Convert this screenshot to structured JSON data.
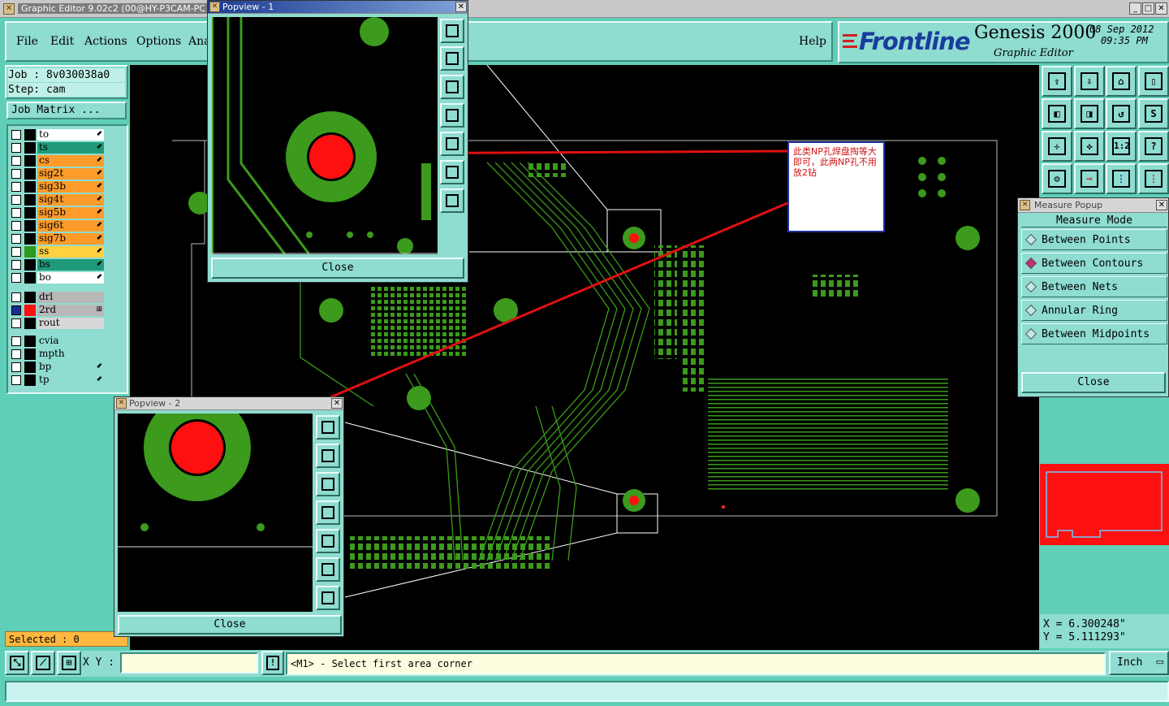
{
  "window": {
    "title": "Graphic Editor 9.02c2 (00@HY-P3CAM-PC"
  },
  "menu": {
    "file": "File",
    "edit": "Edit",
    "actions": "Actions",
    "options": "Options",
    "analysis": "Ana",
    "help": "Help"
  },
  "logo": {
    "brand": "Frontline",
    "product": "Genesis 2000",
    "subtitle": "Graphic Editor",
    "date": "08 Sep 2012",
    "time": "09:35 PM"
  },
  "job": {
    "job_label": "Job : 8v030038a0",
    "step_label": "Step: cam",
    "matrix_button": "Job Matrix ..."
  },
  "layers": [
    {
      "name": "to",
      "color": "#ffffff",
      "arrow": "⬋"
    },
    {
      "name": "ts",
      "color": "#1e9a7a",
      "arrow": "⬋"
    },
    {
      "name": "cs",
      "color": "#ff9b2a",
      "arrow": "⬋"
    },
    {
      "name": "sig2t",
      "color": "#ff9b2a",
      "arrow": "⬋"
    },
    {
      "name": "sig3b",
      "color": "#ff9b2a",
      "arrow": "⬋"
    },
    {
      "name": "sig4t",
      "color": "#ff9b2a",
      "arrow": "⬋"
    },
    {
      "name": "sig5b",
      "color": "#ff9b2a",
      "arrow": "⬋"
    },
    {
      "name": "sig6t",
      "color": "#ff9b2a",
      "arrow": "⬋"
    },
    {
      "name": "sig7b",
      "color": "#ff9b2a",
      "arrow": "⬋"
    },
    {
      "name": "ss",
      "color": "#ffd040",
      "arrow": "⬋"
    },
    {
      "name": "bs",
      "color": "#1e9a7a",
      "arrow": "⬋"
    },
    {
      "name": "bo",
      "color": "#ffffff",
      "arrow": "⬋"
    }
  ],
  "drill_layers": [
    {
      "name": "drl",
      "color": "#b8b8b8",
      "arrow": ""
    },
    {
      "name": "2rd",
      "color": "#b8b8b8",
      "arrow": "⊞"
    },
    {
      "name": "rout",
      "color": "#d8d8d8",
      "arrow": ""
    }
  ],
  "misc_layers": [
    {
      "name": "cvia",
      "color": "#8fdcd0",
      "arrow": ""
    },
    {
      "name": "mpth",
      "color": "#8fdcd0",
      "arrow": ""
    },
    {
      "name": "bp",
      "color": "#8fdcd0",
      "arrow": "⬋"
    },
    {
      "name": "tp",
      "color": "#8fdcd0",
      "arrow": "⬋"
    }
  ],
  "selected_label": "Selected : 0",
  "popview1": {
    "title": "Popview - 1",
    "close": "Close"
  },
  "popview2": {
    "title": "Popview - 2",
    "close": "Close"
  },
  "annotation": {
    "text": "此类NP孔焊盘掏等大即可，此两NP孔不用放2钻"
  },
  "measure": {
    "title": "Measure Popup",
    "heading": "Measure Mode",
    "options": [
      "Between Points",
      "Between Contours",
      "Between Nets",
      "Annular Ring",
      "Between Midpoints"
    ],
    "selected": "Between Contours",
    "close": "Close"
  },
  "coords": {
    "x": "X  =  6.300248\"",
    "y": "Y  =  5.111293\""
  },
  "bottom": {
    "xy_label": "X Y :",
    "xy_value": "",
    "prompt": "<M1> - Select first area corner",
    "units": "Inch"
  },
  "toolbar_labels": {
    "scale": "1:2",
    "help": "?"
  }
}
